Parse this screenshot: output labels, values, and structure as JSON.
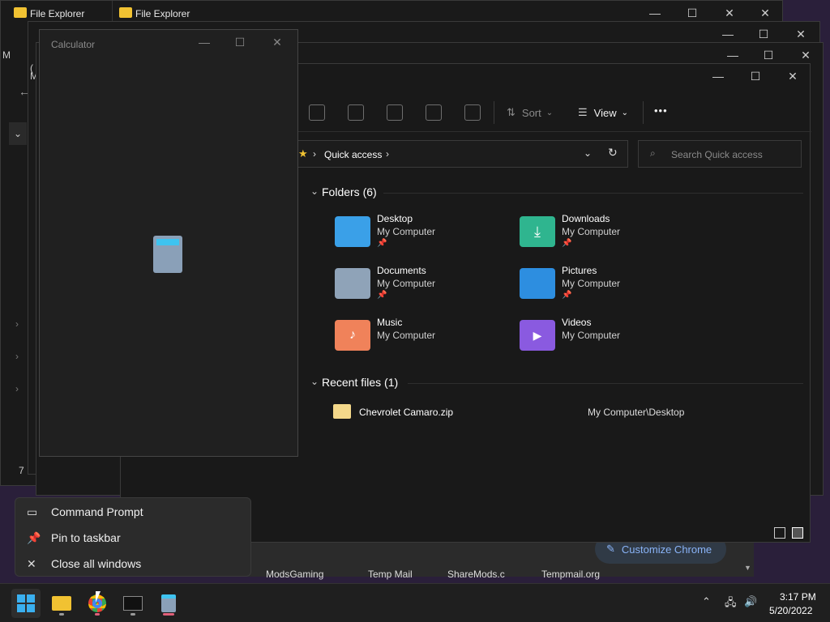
{
  "windows": {
    "explorer_back_1": {
      "title": "File Explorer"
    },
    "explorer_back_2": {
      "title": "File Explorer"
    },
    "calculator": {
      "title": "Calculator"
    }
  },
  "explorer": {
    "toolbar": {
      "sort_label": "Sort",
      "view_label": "View",
      "more": "•••"
    },
    "address": {
      "path_label": "Quick access",
      "search_placeholder": "Search Quick access"
    },
    "folders_header": "Folders (6)",
    "folders": [
      {
        "name": "Desktop",
        "location": "My Computer",
        "pinned": true,
        "color": "#3aa0e8"
      },
      {
        "name": "Downloads",
        "location": "My Computer",
        "pinned": true,
        "color": "#2fb58f"
      },
      {
        "name": "Documents",
        "location": "My Computer",
        "pinned": true,
        "color": "#8fa3b8"
      },
      {
        "name": "Pictures",
        "location": "My Computer",
        "pinned": true,
        "color": "#2d8ee0"
      },
      {
        "name": "Music",
        "location": "My Computer",
        "pinned": false,
        "color": "#f0825a"
      },
      {
        "name": "Videos",
        "location": "My Computer",
        "pinned": false,
        "color": "#8a5ae0"
      }
    ],
    "recent_header": "Recent files (1)",
    "recent_files": [
      {
        "name": "Chevrolet Camaro.zip",
        "location": "My Computer\\Desktop"
      }
    ]
  },
  "background_partial": {
    "chrome_customize": "Customize Chrome",
    "shortcuts": [
      "ModsGaming",
      "Temp Mail",
      "ShareMods.c",
      "Tempmail.org"
    ],
    "left_fragments": [
      "M",
      "(",
      "M",
      "7"
    ]
  },
  "jump_list": {
    "items": [
      {
        "label": "Command Prompt",
        "icon": "cmd-icon"
      },
      {
        "label": "Pin to taskbar",
        "icon": "pin-icon"
      },
      {
        "label": "Close all windows",
        "icon": "close-icon"
      }
    ]
  },
  "taskbar": {
    "apps": [
      "start-icon",
      "file-explorer-icon",
      "chrome-icon",
      "terminal-icon",
      "calculator-icon"
    ],
    "clock_time": "3:17 PM",
    "clock_date": "5/20/2022"
  }
}
